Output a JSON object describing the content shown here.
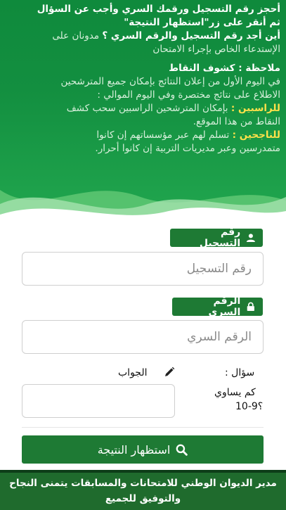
{
  "colors": {
    "primary": "#1e7a34",
    "hero_top": "#0f8a3c",
    "highlight": "#ffe14a",
    "footer": "#1f6b2d"
  },
  "hero": {
    "l1": "أحجز رقم التسجيل ورقمك السري وأجب عن السؤال",
    "l2": "ثم أنقر على زر\"استظهار النتيجة\"",
    "l3_bold": "أين أجد رقم التسجيل والرقم السري ؟",
    "l3_light": " مدونان على",
    "l4": "الإستدعاء الخاص بإجراء الامتحان",
    "note_title": "ملاحظة : كشوف النقاط",
    "n1": "في اليوم الأول من إعلان النتائج بإمكان جميع المترشحين",
    "n2": "الاطلاع على نتائج مختصرة وفي اليوم الموالي :",
    "fail_label": "للراسبين :",
    "fail_text": " بإمكان المترشحين الراسبين سحب كشف",
    "fail_text2": "النقاط من هذا الموقع.",
    "pass_label": "للناجحين :",
    "pass_text": " تسلم لهم عبر مؤسساتهم إن كانوا",
    "pass_text2": "متمدرسين وعبر مديريات التربية إن كانوا أحرار."
  },
  "form": {
    "reg_label": "رقم التسجيل",
    "reg_placeholder": "رقم التسجيل",
    "pass_label": "الرقم السري",
    "pass_placeholder": "الرقم السري",
    "question_label": "سؤال :",
    "question_text1": "كم يساوي",
    "question_text2": "10-9؟",
    "answer_label": "الجواب",
    "answer_value": "",
    "submit_label": "استظهار النتيجة",
    "icons": {
      "user": "user-icon",
      "lock": "lock-icon",
      "pencil": "pencil-icon",
      "search": "search-icon"
    }
  },
  "footer": {
    "line1": "مدير الديوان الوطني للامتحانات والمسابقات يتمنى النجاح",
    "line2": "والتوفيق للجميع"
  }
}
